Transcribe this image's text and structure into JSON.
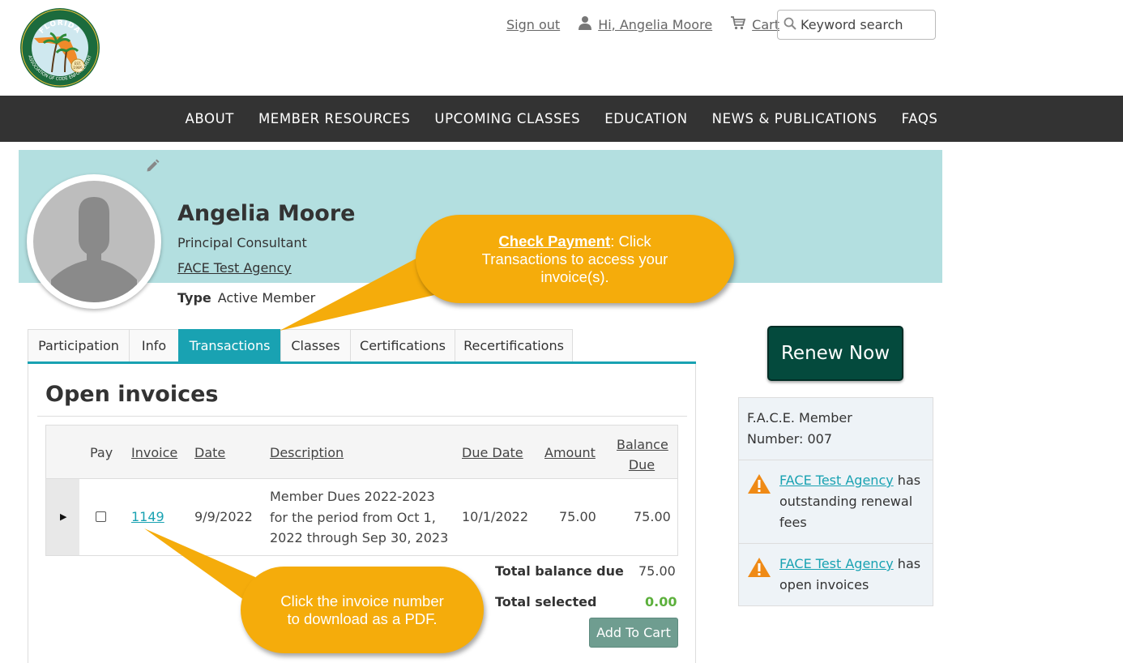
{
  "header": {
    "logo": {
      "top_text": "FLORIDA",
      "bottom_text": "ASSOCIATION OF CODE ENFORCEMENT",
      "est": "EST.",
      "year": "1989"
    },
    "sign_out": "Sign out",
    "greeting": "Hi, Angelia Moore",
    "cart": "Cart",
    "search_placeholder": "Keyword search"
  },
  "nav": [
    "ABOUT",
    "MEMBER RESOURCES",
    "UPCOMING CLASSES",
    "EDUCATION",
    "NEWS & PUBLICATIONS",
    "FAQS"
  ],
  "profile": {
    "name": "Angelia Moore",
    "title": "Principal Consultant",
    "agency": "FACE Test Agency",
    "type_label": "Type",
    "type_value": "Active Member"
  },
  "tabs": [
    {
      "label": "Participation",
      "active": false
    },
    {
      "label": "Info",
      "active": false
    },
    {
      "label": "Transactions",
      "active": true
    },
    {
      "label": "Classes",
      "active": false
    },
    {
      "label": "Certifications",
      "active": false
    },
    {
      "label": "Recertifications",
      "active": false
    }
  ],
  "invoices": {
    "title": "Open invoices",
    "headers": {
      "pay": "Pay",
      "invoice": "Invoice",
      "date": "Date",
      "description": "Description",
      "due_date": "Due Date",
      "amount": "Amount",
      "balance_1": "Balance",
      "balance_2": "Due"
    },
    "rows": [
      {
        "invoice": "1149",
        "date": "9/9/2022",
        "desc_1": "Member Dues 2022-2023",
        "desc_2": "for the period from Oct 1,",
        "desc_3": "2022 through Sep 30, 2023",
        "due_date": "10/1/2022",
        "amount": "75.00",
        "balance": "75.00"
      }
    ],
    "total_balance_label": "Total balance due",
    "total_balance_value": "75.00",
    "total_selected_label": "Total selected",
    "total_selected_value": "0.00",
    "add_to_cart": "Add To Cart"
  },
  "sidebar": {
    "renew": "Renew Now",
    "member_number_1": "F.A.C.E. Member",
    "member_number_2": "Number: 007",
    "alert1": {
      "link": "FACE Test Agency",
      "text_1": " has",
      "text_2": "outstanding renewal",
      "text_3": "fees"
    },
    "alert2": {
      "link": "FACE Test Agency",
      "text_1": " has",
      "text_2": "open invoices"
    }
  },
  "callouts": {
    "c1_bold": "Check Payment",
    "c1_text": ": Click Transactions to access your invoice(s).",
    "c2_text": "Click the invoice number to download as a PDF."
  },
  "colors": {
    "accent": "#19a2b2",
    "nav_bg": "#333333",
    "banner_bg": "#b3dfe0",
    "renew_bg": "#044a3d",
    "callout": "#f5ac0b"
  }
}
